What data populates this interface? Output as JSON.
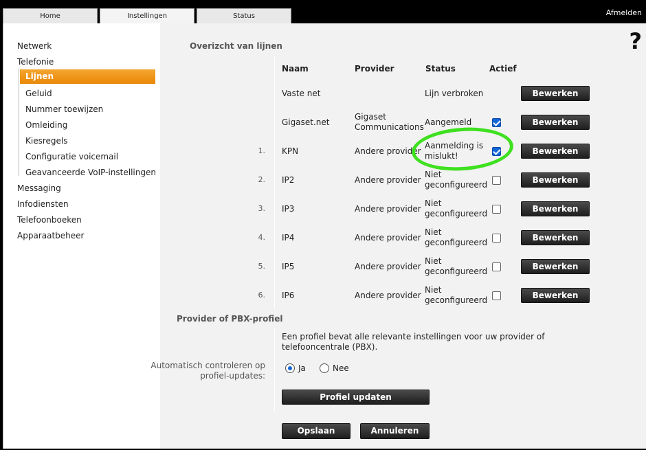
{
  "tabs": [
    "Home",
    "Instellingen",
    "Status"
  ],
  "logout": "Afmelden",
  "help": "?",
  "sidebar": {
    "items": [
      "Netwerk",
      "Telefonie",
      "Messaging",
      "Infodiensten",
      "Telefoonboeken",
      "Apparaatbeheer"
    ],
    "subitems": [
      "Lijnen",
      "Geluid",
      "Nummer toewijzen",
      "Omleiding",
      "Kiesregels",
      "Configuratie voicemail",
      "Geavanceerde VoIP-instellingen"
    ]
  },
  "lines": {
    "title": "Overizcht van lijnen",
    "headers": {
      "name": "Naam",
      "provider": "Provider",
      "status": "Status",
      "active": "Actief"
    },
    "rows": [
      {
        "num": "",
        "name": "Vaste net",
        "provider1": "",
        "provider2": "",
        "status1": "Lijn verbroken",
        "status2": "",
        "active": null,
        "button": "Bewerken"
      },
      {
        "num": "",
        "name": "Gigaset.net",
        "provider1": "Gigaset",
        "provider2": "Communications",
        "status1": "Aangemeld",
        "status2": "",
        "active": true,
        "button": "Bewerken"
      },
      {
        "num": "1.",
        "name": "KPN",
        "provider1": "Andere provider",
        "provider2": "",
        "status1": "Aanmelding is",
        "status2": "mislukt!",
        "active": true,
        "button": "Bewerken"
      },
      {
        "num": "2.",
        "name": "IP2",
        "provider1": "Andere provider",
        "provider2": "",
        "status1": "Niet",
        "status2": "geconfigureerd",
        "active": false,
        "button": "Bewerken"
      },
      {
        "num": "3.",
        "name": "IP3",
        "provider1": "Andere provider",
        "provider2": "",
        "status1": "Niet",
        "status2": "geconfigureerd",
        "active": false,
        "button": "Bewerken"
      },
      {
        "num": "4.",
        "name": "IP4",
        "provider1": "Andere provider",
        "provider2": "",
        "status1": "Niet",
        "status2": "geconfigureerd",
        "active": false,
        "button": "Bewerken"
      },
      {
        "num": "5.",
        "name": "IP5",
        "provider1": "Andere provider",
        "provider2": "",
        "status1": "Niet",
        "status2": "geconfigureerd",
        "active": false,
        "button": "Bewerken"
      },
      {
        "num": "6.",
        "name": "IP6",
        "provider1": "Andere provider",
        "provider2": "",
        "status1": "Niet",
        "status2": "geconfigureerd",
        "active": false,
        "button": "Bewerken"
      }
    ]
  },
  "pbx": {
    "title": "Provider of PBX-profiel",
    "description": "Een profiel bevat alle relevante instellingen voor uw provider of telefooncentrale (PBX).",
    "auto_label_1": "Automatisch controleren op",
    "auto_label_2": "profiel-updates:",
    "option_yes": "Ja",
    "option_no": "Nee",
    "selected": "Ja",
    "update_button": "Profiel updaten"
  },
  "footer": {
    "save": "Opslaan",
    "cancel": "Annuleren"
  },
  "colors": {
    "accent": "#ee8f0d",
    "button": "#2a2a2a",
    "checkbox": "#1565d8",
    "highlight": "#3ee01f"
  }
}
